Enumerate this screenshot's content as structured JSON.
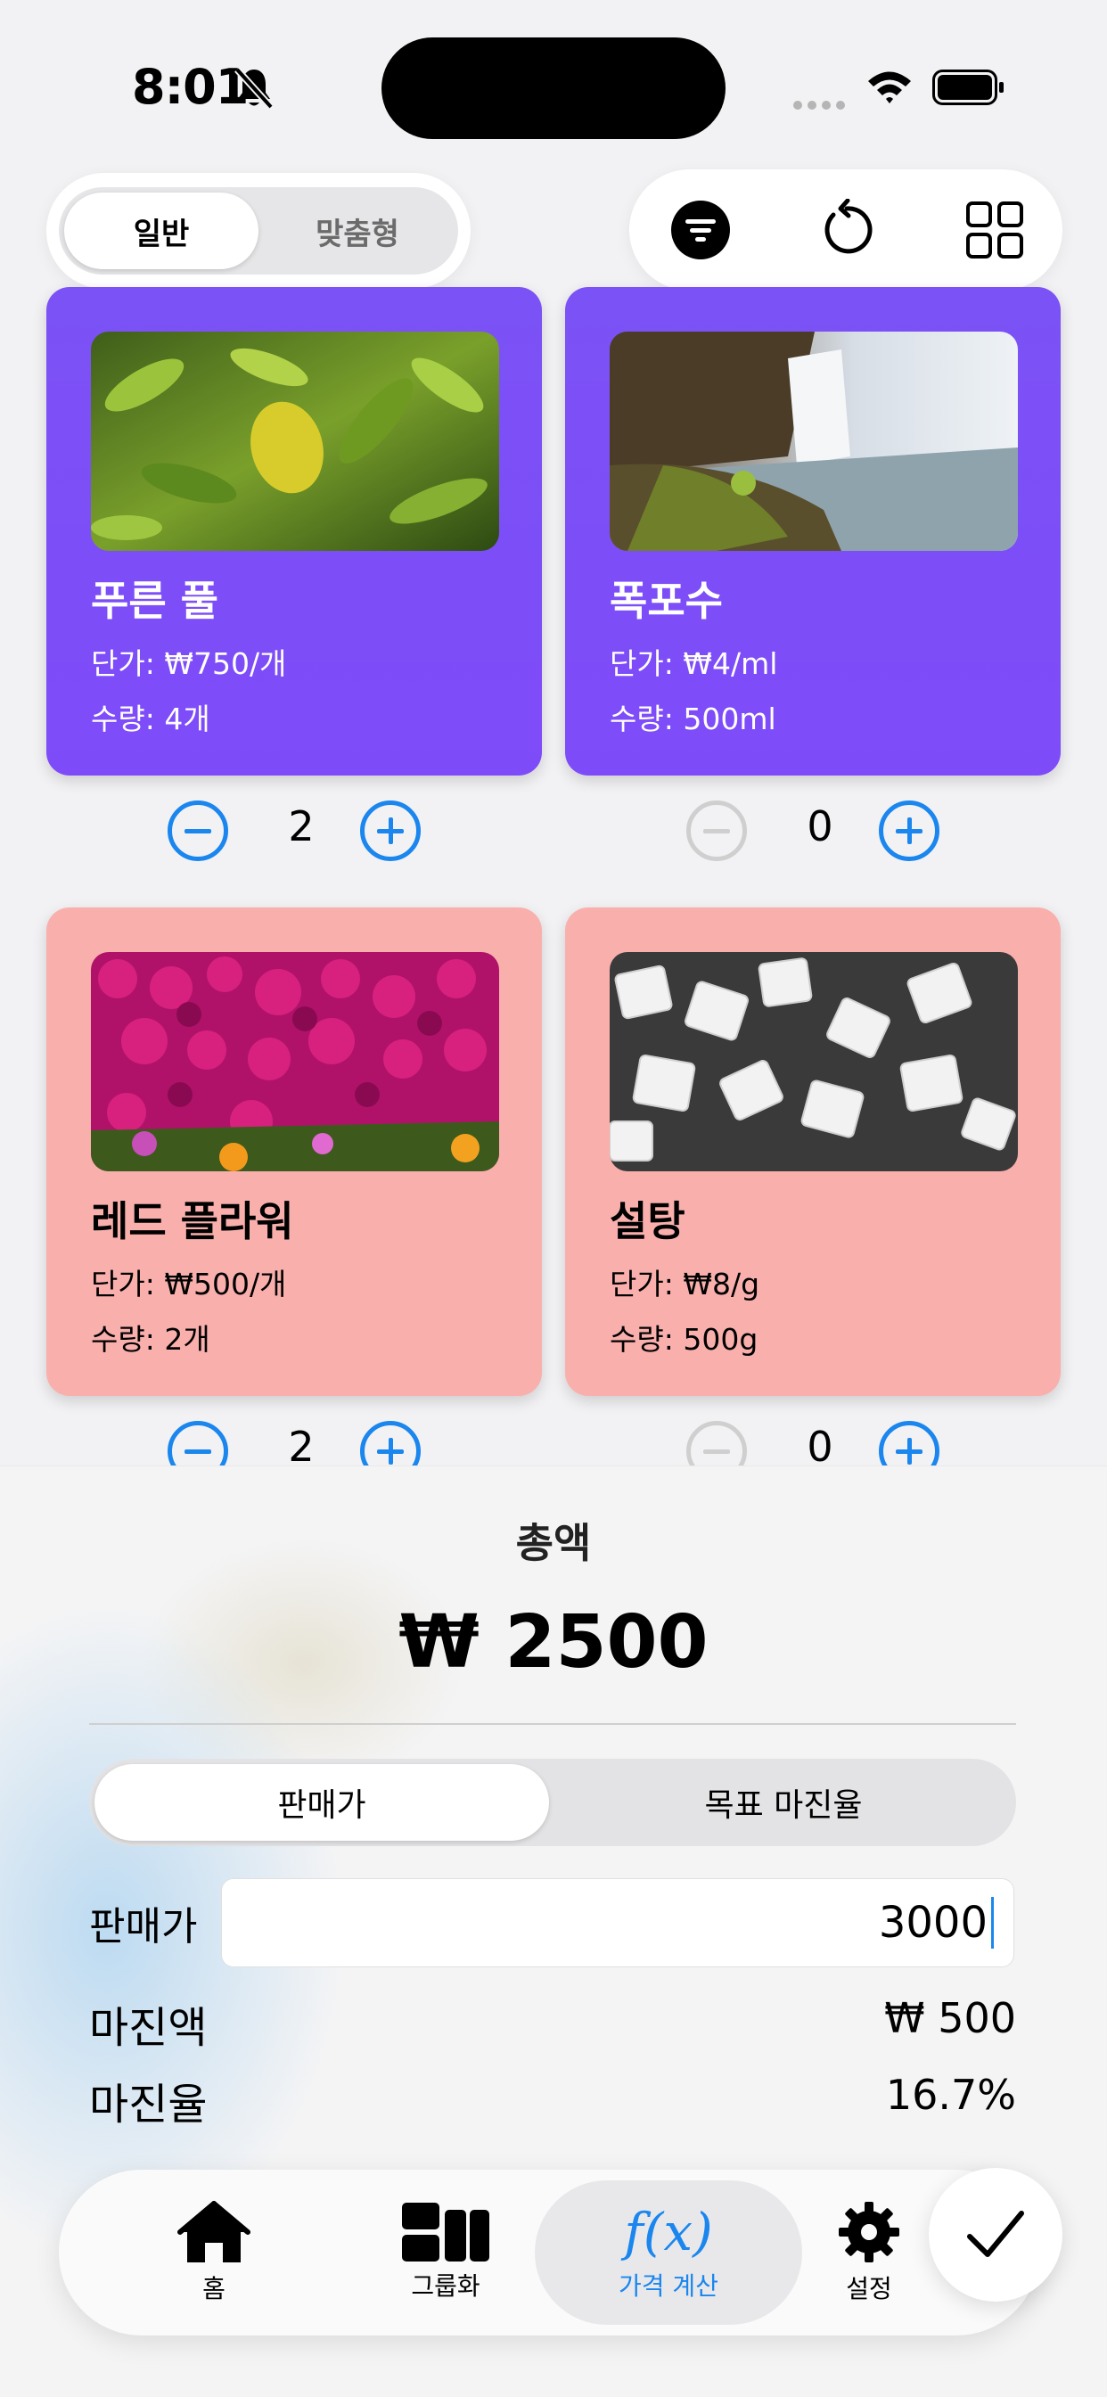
{
  "status_bar": {
    "time": "8:01"
  },
  "top": {
    "segment": {
      "general": "일반",
      "custom": "맞춤형"
    },
    "tools": [
      "filter-icon",
      "refresh-icon",
      "grid-icon"
    ]
  },
  "cards": [
    {
      "name": "푸른 풀",
      "price": "단가: ₩750/개",
      "qty": "수량: 4개",
      "count": "2",
      "color": "#7c4ef8"
    },
    {
      "name": "폭포수",
      "price": "단가: ₩4/ml",
      "qty": "수량: 500ml",
      "count": "0",
      "color": "#7c4ef8"
    },
    {
      "name": "레드 플라워",
      "price": "단가: ₩500/개",
      "qty": "수량: 2개",
      "count": "2",
      "color": "#f9b0ad"
    },
    {
      "name": "설탕",
      "price": "단가: ₩8/g",
      "qty": "수량: 500g",
      "count": "0",
      "color": "#f9b0ad"
    }
  ],
  "sheet": {
    "total_label": "총액",
    "total_value": "₩ 2500",
    "mode": {
      "sale_price": "판매가",
      "target_margin": "목표 마진율"
    },
    "price_label": "판매가",
    "price_value": "3000",
    "margin_amount_label": "마진액",
    "margin_amount_value": "₩ 500",
    "margin_rate_label": "마진율",
    "margin_rate_value": "16.7%"
  },
  "tabbar": {
    "home": "홈",
    "group": "그룹화",
    "price_calc": "가격 계산",
    "price_calc_icon": "f(x)",
    "settings": "설정"
  },
  "colors": {
    "accent": "#1a86ee",
    "purple_card": "#7c4ef8",
    "pink_card": "#f9b0ad"
  }
}
